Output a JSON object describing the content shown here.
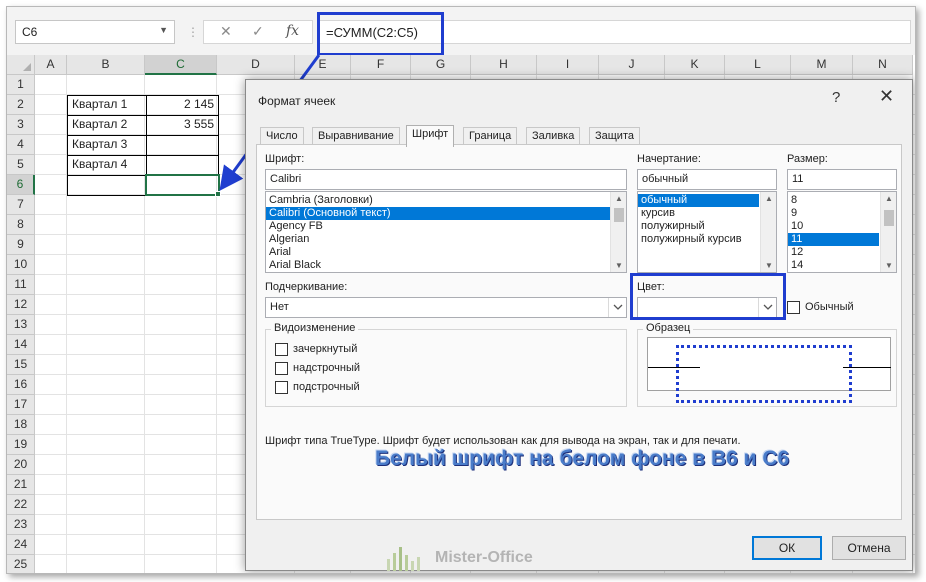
{
  "formula_bar": {
    "name_box": "C6",
    "cancel_symbol": "✕",
    "enter_symbol": "✓",
    "fx_symbol": "fx",
    "formula": "=СУММ(C2:C5)"
  },
  "sheet": {
    "columns": [
      "A",
      "B",
      "C",
      "D",
      "E",
      "F",
      "G",
      "H",
      "I",
      "J",
      "K",
      "L",
      "M",
      "N"
    ],
    "rows": [
      "1",
      "2",
      "3",
      "4",
      "5",
      "6",
      "7",
      "8",
      "9",
      "10",
      "11",
      "12",
      "13",
      "14",
      "15",
      "16",
      "17",
      "18",
      "19",
      "20",
      "21",
      "22",
      "23",
      "24",
      "25"
    ],
    "selected_column": "C",
    "selected_row": "6",
    "cells": {
      "b2": "Квартал 1",
      "c2": "2 145",
      "b3": "Квартал 2",
      "c3": "3 555",
      "b4": "Квартал 3",
      "b5": "Квартал 4"
    }
  },
  "dialog": {
    "title": "Формат ячеек",
    "help": "?",
    "close": "✕",
    "tabs": [
      "Число",
      "Выравнивание",
      "Шрифт",
      "Граница",
      "Заливка",
      "Защита"
    ],
    "active_tab": "Шрифт",
    "font": {
      "label": "Шрифт:",
      "value": "Calibri",
      "items": [
        "Cambria (Заголовки)",
        "Calibri (Основной текст)",
        "Agency FB",
        "Algerian",
        "Arial",
        "Arial Black"
      ],
      "selected": "Calibri (Основной текст)"
    },
    "style": {
      "label": "Начертание:",
      "value": "обычный",
      "items": [
        "обычный",
        "курсив",
        "полужирный",
        "полужирный курсив"
      ],
      "selected": "обычный"
    },
    "size": {
      "label": "Размер:",
      "value": "11",
      "items": [
        "8",
        "9",
        "10",
        "11",
        "12",
        "14"
      ],
      "selected": "11"
    },
    "underline": {
      "label": "Подчеркивание:",
      "value": "Нет"
    },
    "color": {
      "label": "Цвет:",
      "value": "",
      "normal_label": "Обычный"
    },
    "effects": {
      "title": "Видоизменение",
      "items": [
        "зачеркнутый",
        "надстрочный",
        "подстрочный"
      ]
    },
    "preview": {
      "title": "Образец"
    },
    "info": "Шрифт типа TrueType. Шрифт будет использован как для вывода на экран, так и для печати.",
    "ok": "ОК",
    "cancel": "Отмена"
  },
  "annotation": {
    "banner": "Белый шрифт на белом фоне в B6 и C6",
    "watermark": "Mister-Office",
    "accent_color": "#1f3dcf",
    "banner_color": "#4a7cc9"
  }
}
